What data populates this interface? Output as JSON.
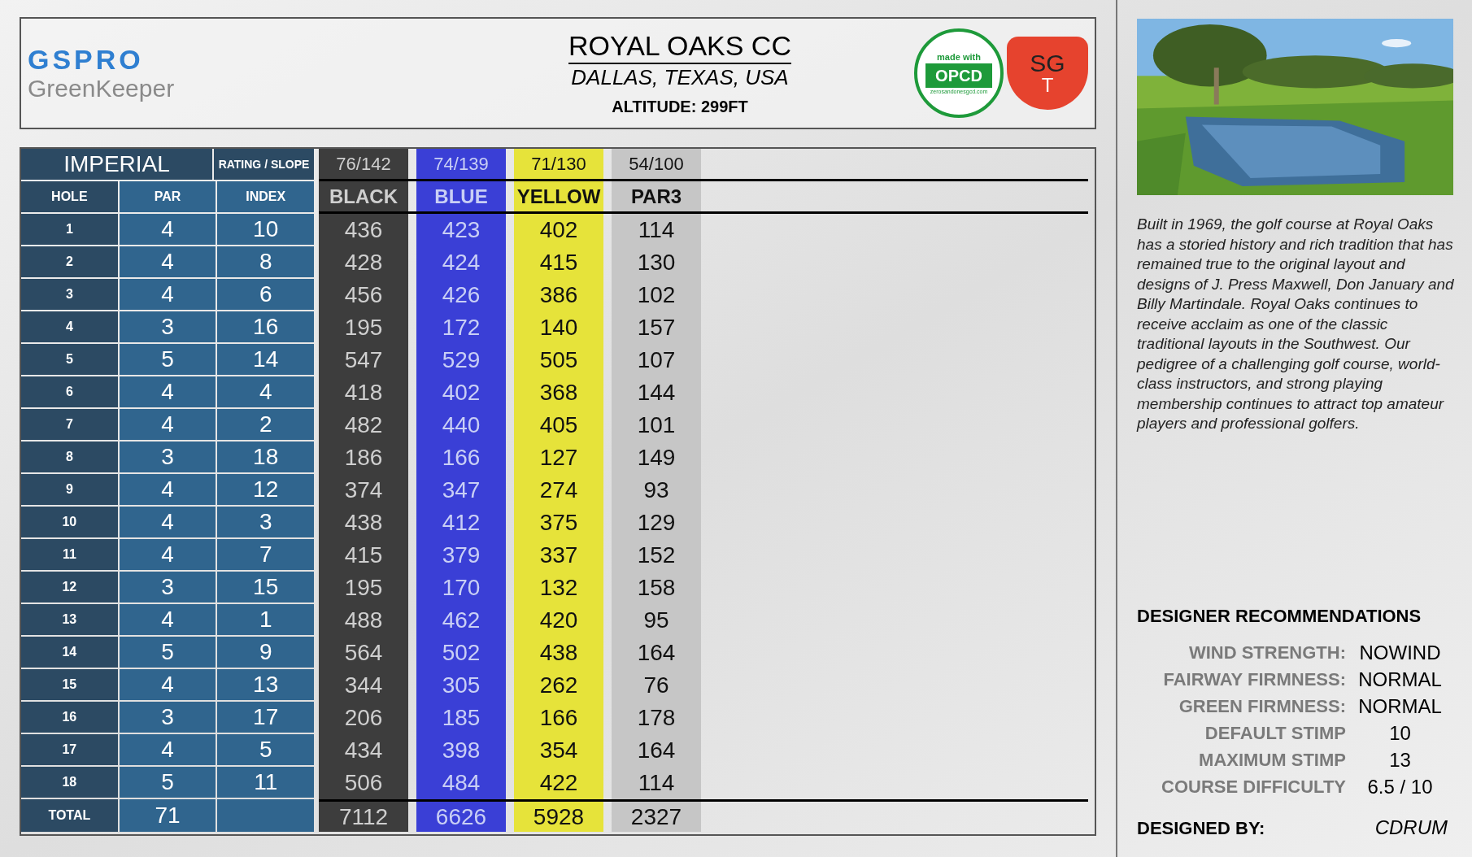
{
  "logo": {
    "brand": "GSPRO",
    "product": "GreenKeeper"
  },
  "course": {
    "name": "ROYAL OAKS CC",
    "location": "DALLAS, TEXAS, USA",
    "altitude": "ALTITUDE: 299FT"
  },
  "badges": {
    "opcd_top": "made with",
    "opcd": "OPCD",
    "opcd_url": "zerosandonesgcd.com",
    "sgt_top": "SG",
    "sgt_bottom": "T"
  },
  "scorecard": {
    "units": "IMPERIAL",
    "rating_label": "RATING / SLOPE",
    "columns": [
      "HOLE",
      "PAR",
      "INDEX"
    ],
    "tees": [
      {
        "name": "BLACK",
        "rating": "76/142",
        "color": "#3d3d3d",
        "total": "7112"
      },
      {
        "name": "BLUE",
        "rating": "74/139",
        "color": "#3a3fd6",
        "total": "6626"
      },
      {
        "name": "YELLOW",
        "rating": "71/130",
        "color": "#e6e33a",
        "total": "5928"
      },
      {
        "name": "PAR3",
        "rating": "54/100",
        "color": "#c6c6c6",
        "total": "2327"
      }
    ],
    "rows": [
      {
        "hole": "1",
        "par": "4",
        "index": "10",
        "yards": [
          "436",
          "423",
          "402",
          "114"
        ]
      },
      {
        "hole": "2",
        "par": "4",
        "index": "8",
        "yards": [
          "428",
          "424",
          "415",
          "130"
        ]
      },
      {
        "hole": "3",
        "par": "4",
        "index": "6",
        "yards": [
          "456",
          "426",
          "386",
          "102"
        ]
      },
      {
        "hole": "4",
        "par": "3",
        "index": "16",
        "yards": [
          "195",
          "172",
          "140",
          "157"
        ]
      },
      {
        "hole": "5",
        "par": "5",
        "index": "14",
        "yards": [
          "547",
          "529",
          "505",
          "107"
        ]
      },
      {
        "hole": "6",
        "par": "4",
        "index": "4",
        "yards": [
          "418",
          "402",
          "368",
          "144"
        ]
      },
      {
        "hole": "7",
        "par": "4",
        "index": "2",
        "yards": [
          "482",
          "440",
          "405",
          "101"
        ]
      },
      {
        "hole": "8",
        "par": "3",
        "index": "18",
        "yards": [
          "186",
          "166",
          "127",
          "149"
        ]
      },
      {
        "hole": "9",
        "par": "4",
        "index": "12",
        "yards": [
          "374",
          "347",
          "274",
          "93"
        ]
      },
      {
        "hole": "10",
        "par": "4",
        "index": "3",
        "yards": [
          "438",
          "412",
          "375",
          "129"
        ]
      },
      {
        "hole": "11",
        "par": "4",
        "index": "7",
        "yards": [
          "415",
          "379",
          "337",
          "152"
        ]
      },
      {
        "hole": "12",
        "par": "3",
        "index": "15",
        "yards": [
          "195",
          "170",
          "132",
          "158"
        ]
      },
      {
        "hole": "13",
        "par": "4",
        "index": "1",
        "yards": [
          "488",
          "462",
          "420",
          "95"
        ]
      },
      {
        "hole": "14",
        "par": "5",
        "index": "9",
        "yards": [
          "564",
          "502",
          "438",
          "164"
        ]
      },
      {
        "hole": "15",
        "par": "4",
        "index": "13",
        "yards": [
          "344",
          "305",
          "262",
          "76"
        ]
      },
      {
        "hole": "16",
        "par": "3",
        "index": "17",
        "yards": [
          "206",
          "185",
          "166",
          "178"
        ]
      },
      {
        "hole": "17",
        "par": "4",
        "index": "5",
        "yards": [
          "434",
          "398",
          "354",
          "164"
        ]
      },
      {
        "hole": "18",
        "par": "5",
        "index": "11",
        "yards": [
          "506",
          "484",
          "422",
          "114"
        ]
      }
    ],
    "total_label": "TOTAL",
    "total_par": "71"
  },
  "description": "Built in 1969, the golf course at Royal Oaks has a storied history and rich tradition that has remained true to the original layout and designs of J. Press Maxwell, Don January and Billy Martindale. Royal Oaks continues to receive acclaim as one of the classic traditional layouts in the Southwest. Our pedigree of a challenging golf course, world-class instructors, and strong playing membership continues to attract top amateur players and professional golfers.",
  "recommendations": {
    "title": "DESIGNER RECOMMENDATIONS",
    "items": [
      {
        "label": "WIND STRENGTH:",
        "value": "NOWIND"
      },
      {
        "label": "FAIRWAY FIRMNESS:",
        "value": "NORMAL"
      },
      {
        "label": "GREEN FIRMNESS:",
        "value": "NORMAL"
      },
      {
        "label": "DEFAULT STIMP",
        "value": "10"
      },
      {
        "label": "MAXIMUM STIMP",
        "value": "13"
      },
      {
        "label": "COURSE DIFFICULTY",
        "value": "6.5 / 10"
      }
    ],
    "designed_by_label": "DESIGNED BY:",
    "designer": "CDRUM"
  }
}
